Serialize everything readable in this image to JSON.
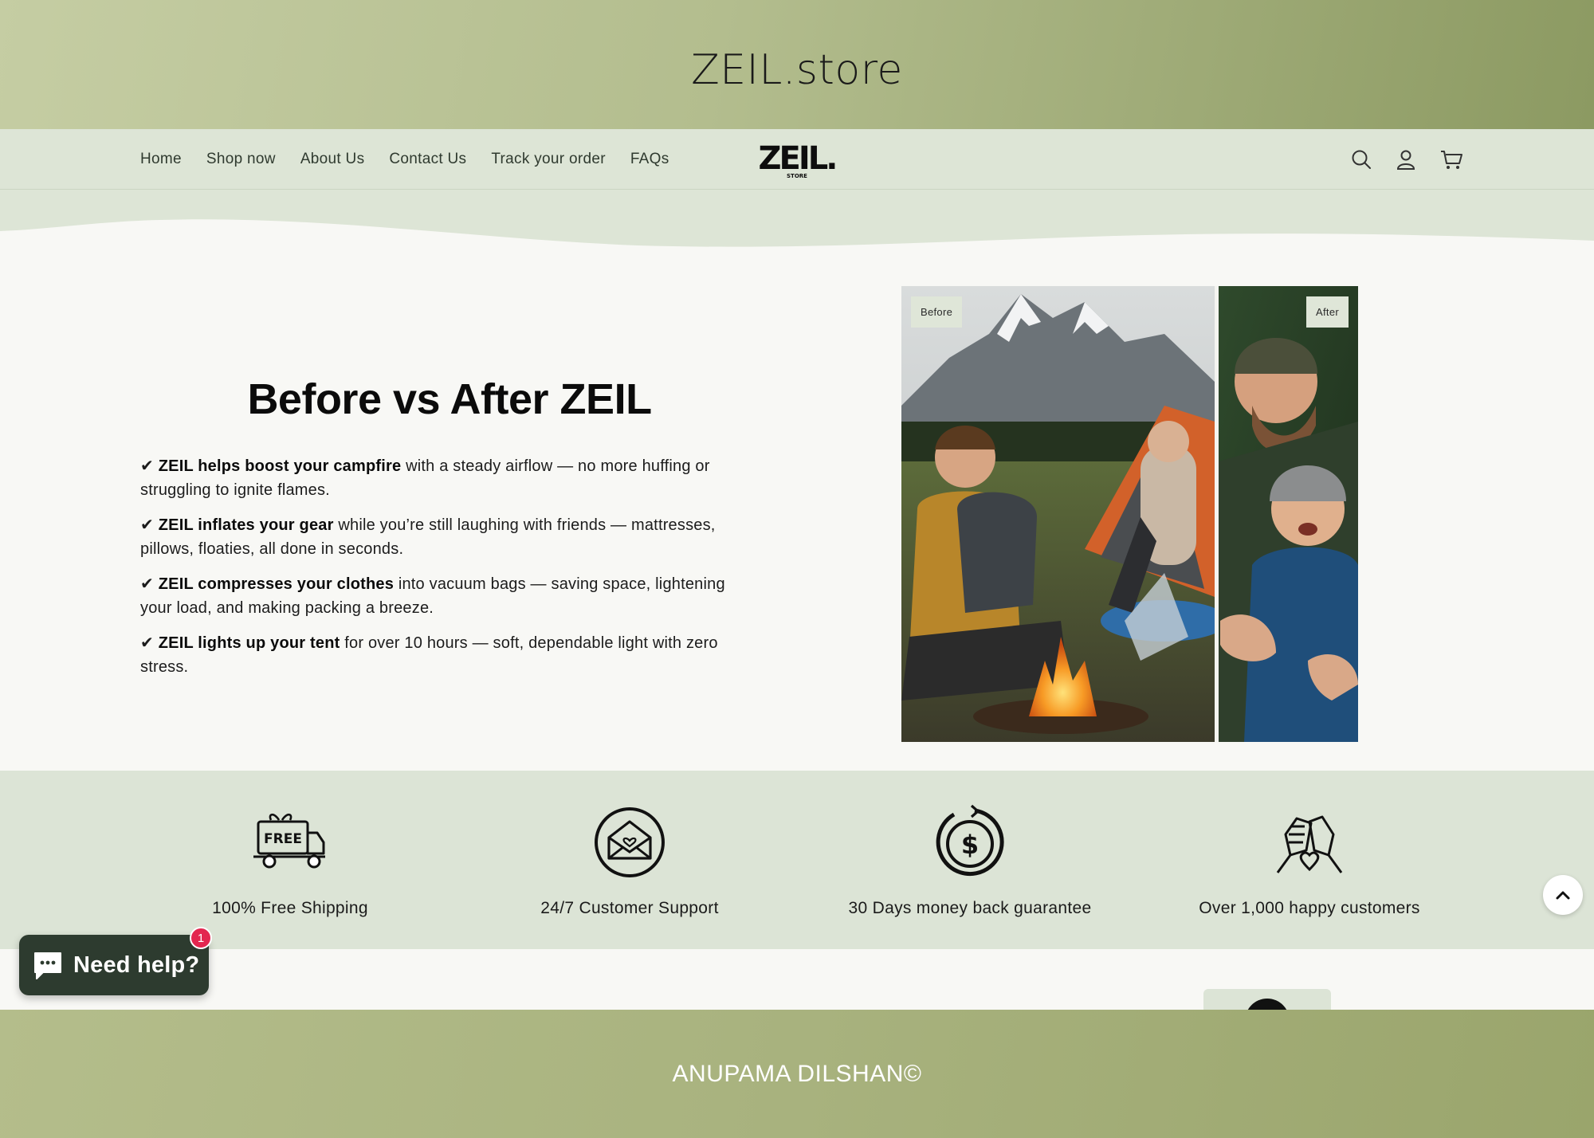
{
  "banner": {
    "title": "ZEIL.store"
  },
  "nav": {
    "links": [
      "Home",
      "Shop now",
      "About Us",
      "Contact Us",
      "Track your order",
      "FAQs"
    ],
    "logo_text": "ZEIL.",
    "logo_subtext": "STORE",
    "icons": [
      "search-icon",
      "account-icon",
      "cart-icon"
    ]
  },
  "hero": {
    "title": "Before vs After ZEIL",
    "bullets": [
      {
        "check": "✔",
        "bold": "ZEIL helps boost your campfire",
        "text": " with a steady airflow — no more huffing or struggling to ignite flames."
      },
      {
        "check": "✔",
        "bold": "ZEIL inflates your gear",
        "text": " while you’re still laughing with friends — mattresses, pillows, floaties, all done in seconds."
      },
      {
        "check": "✔",
        "bold": "ZEIL compresses your clothes",
        "text": " into vacuum bags — saving space, lightening your load, and making packing a breeze."
      },
      {
        "check": "✔",
        "bold": "ZEIL lights up your tent",
        "text": " for over 10 hours — soft, dependable light with zero stress."
      }
    ]
  },
  "compare": {
    "before_label": "Before",
    "after_label": "After",
    "slider_position": 0.69
  },
  "features": [
    {
      "icon": "free-delivery-truck-icon",
      "icon_text": "FREE",
      "label": "100% Free Shipping"
    },
    {
      "icon": "support-envelope-icon",
      "label": "24/7 Customer Support"
    },
    {
      "icon": "money-back-icon",
      "label": "30 Days money back guarantee"
    },
    {
      "icon": "handshake-heart-icon",
      "label": "Over 1,000 happy customers"
    }
  ],
  "help_widget": {
    "label": "Need help?",
    "badge_count": "1"
  },
  "footer": {
    "copyright": "ANUPAMA DILSHAN©"
  },
  "colors": {
    "banner": "#b3bd8e",
    "nav_bg": "#dde5d6",
    "feature_bg": "#dce4d6",
    "help_bg": "#2d3b2f",
    "badge": "#e3264f",
    "footer": "#a8b27e"
  }
}
